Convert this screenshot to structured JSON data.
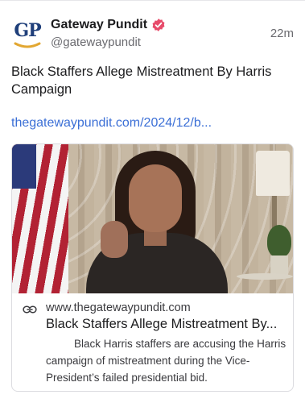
{
  "account": {
    "name": "Gateway Pundit",
    "handle": "@gatewaypundit",
    "avatar_text": "GP",
    "time": "22m"
  },
  "post": {
    "text": "Black Staffers Allege Mistreatment By Harris Campaign",
    "link": "thegatewaypundit.com/2024/12/b..."
  },
  "card": {
    "domain": "www.thegatewaypundit.com",
    "title": "Black Staffers Allege Mistreatment By...",
    "description": "Black Harris staffers are accusing the Harris campaign of mistreatment during the Vice-President’s failed presidential bid."
  },
  "colors": {
    "verified_badge": "#e74c6b",
    "link": "#3b6fd6",
    "avatar_navy": "#1f3f7a",
    "avatar_gold": "#e2a732"
  },
  "icons": {
    "verified": "verified-check-icon",
    "link": "link-chain-icon"
  }
}
